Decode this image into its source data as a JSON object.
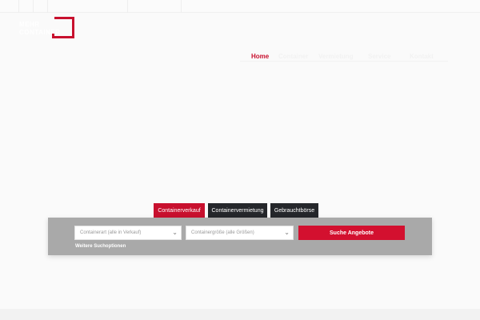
{
  "header": {
    "logo_text": "MEHR CONTAINER",
    "brand_color": "#c8102e"
  },
  "nav": {
    "items": [
      {
        "label": "Home"
      },
      {
        "label": "Container"
      },
      {
        "label": "Vermietung"
      },
      {
        "label": "Service"
      },
      {
        "label": "Kontakt"
      }
    ]
  },
  "search": {
    "tabs": [
      {
        "label": "Containerverkauf",
        "active": true
      },
      {
        "label": "Containervermietung",
        "active": false
      },
      {
        "label": "Gebrauchtbörse",
        "active": false
      }
    ],
    "container_type": {
      "value": "Containerart (alle in Verkauf)",
      "icon": "chevron-down-icon"
    },
    "container_size": {
      "value": "Containergröße (alle Größen)",
      "icon": "chevron-down-icon"
    },
    "submit_label": "Suche Angebote",
    "more_options_label": "Weitere Suchoptionen"
  },
  "colors": {
    "accent": "#c8102e",
    "dark_tab": "#25272b",
    "panel": "#a9a9a9"
  }
}
